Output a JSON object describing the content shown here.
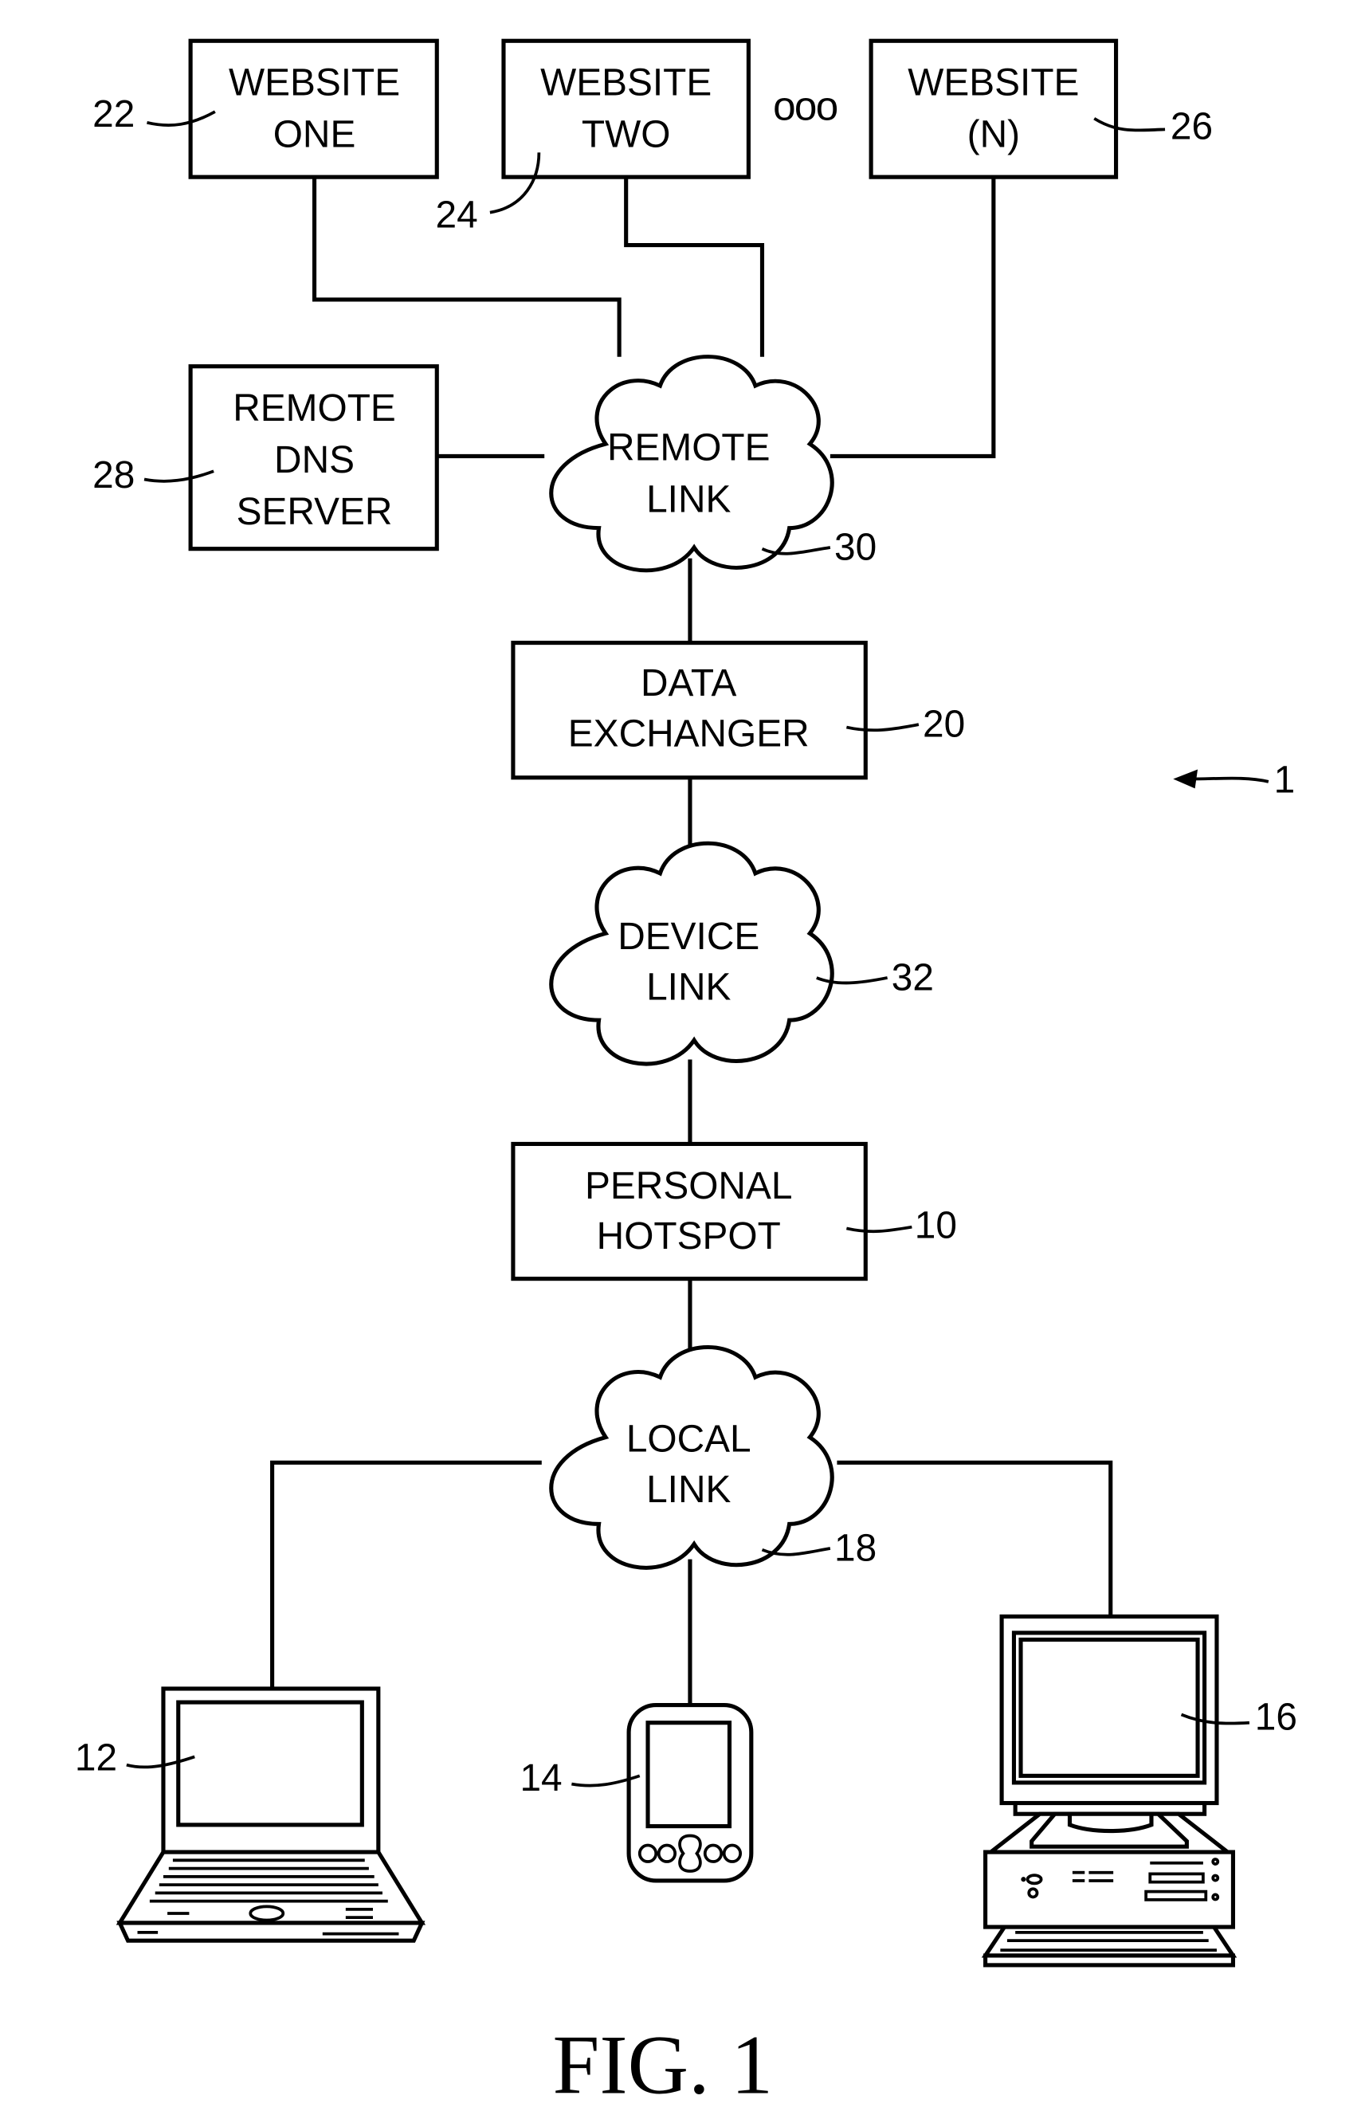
{
  "figure": {
    "caption": "FIG. 1",
    "system_ref": "1"
  },
  "nodes": {
    "website_one": {
      "lines": [
        "WEBSITE",
        "ONE"
      ],
      "ref": "22"
    },
    "website_two": {
      "lines": [
        "WEBSITE",
        "TWO"
      ],
      "ref": "24"
    },
    "website_n": {
      "lines": [
        "WEBSITE",
        "(N)"
      ],
      "ref": "26"
    },
    "ellipsis": "ooo",
    "remote_dns": {
      "lines": [
        "REMOTE",
        "DNS",
        "SERVER"
      ],
      "ref": "28"
    },
    "remote_link": {
      "lines": [
        "REMOTE",
        "LINK"
      ],
      "ref": "30"
    },
    "data_exchanger": {
      "lines": [
        "DATA",
        "EXCHANGER"
      ],
      "ref": "20"
    },
    "device_link": {
      "lines": [
        "DEVICE",
        "LINK"
      ],
      "ref": "32"
    },
    "personal_hotspot": {
      "lines": [
        "PERSONAL",
        "HOTSPOT"
      ],
      "ref": "10"
    },
    "local_link": {
      "lines": [
        "LOCAL",
        "LINK"
      ],
      "ref": "18"
    },
    "laptop": {
      "ref": "12"
    },
    "pda": {
      "ref": "14"
    },
    "desktop": {
      "ref": "16"
    }
  }
}
